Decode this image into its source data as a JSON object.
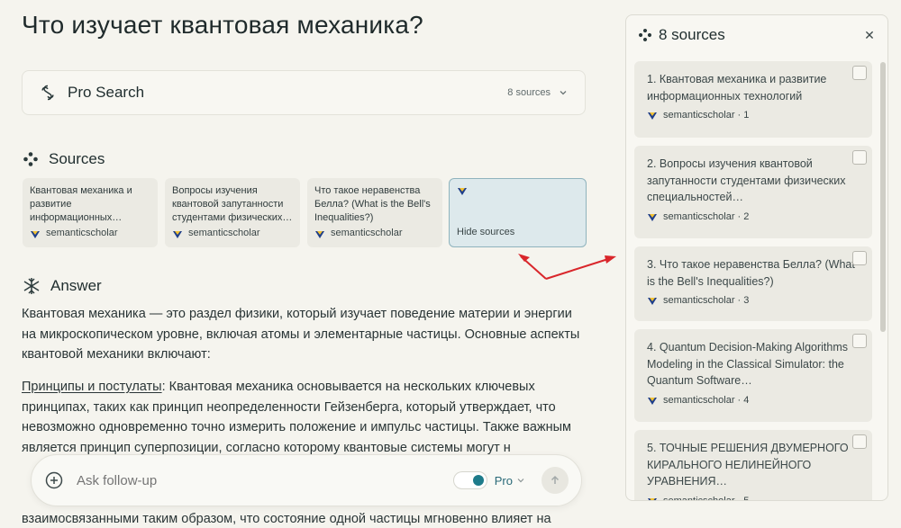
{
  "page_title": "Что изучает квантовая механика?",
  "pro_search": {
    "label": "Pro Search",
    "count": "8 sources"
  },
  "sources_section": {
    "heading": "Sources",
    "cards": [
      {
        "text": "Квантовая механика и развитие информационных…",
        "source": "semanticscholar"
      },
      {
        "text": "Вопросы изучения квантовой запутанности студентами физических…",
        "source": "semanticscholar"
      },
      {
        "text": "Что такое неравенства Белла? (What is the Bell's Inequalities?)",
        "source": "semanticscholar"
      },
      {
        "text": "Hide sources",
        "source": ""
      }
    ]
  },
  "answer": {
    "heading": "Answer",
    "para1": "Квантовая механика — это раздел физики, который изучает поведение материи и энергии на микроскопическом уровне, включая атомы и элементарные частицы. Основные аспекты квантовой механики включают:",
    "para2_term": "Принципы и постулаты",
    "para2_text": ": Квантовая механика основывается на нескольких ключевых принципах, таких как принцип неопределенности Гейзенберга, который утверждает, что невозможно одновременно точно измерить положение и импульс частицы. Также важным является принцип суперпозиции, согласно которому квантовые системы могут н",
    "para3_tail": "взаимосвязанными таким образом, что состояние одной частицы мгновенно влияет на"
  },
  "followup": {
    "placeholder": "Ask follow-up",
    "mode": "Pro"
  },
  "panel": {
    "title": "8 sources",
    "items": [
      {
        "title": "1. Квантовая механика и развитие информационных технологий",
        "meta": "semanticscholar · 1"
      },
      {
        "title": "2. Вопросы изучения квантовой запутанности студентами физических специальностей…",
        "meta": "semanticscholar · 2"
      },
      {
        "title": "3. Что такое неравенства Белла? (What is the Bell's Inequalities?)",
        "meta": "semanticscholar · 3"
      },
      {
        "title": "4. Quantum Decision-Making Algorithms Modeling in the Classical Simulator: the Quantum Software…",
        "meta": "semanticscholar · 4"
      },
      {
        "title": "5. ТОЧНЫЕ РЕШЕНИЯ ДВУМЕРНОГО КИРАЛЬНОГО НЕЛИНЕЙНОГО УРАВНЕНИЯ…",
        "meta": "semanticscholar · 5"
      }
    ]
  },
  "colors": {
    "accent": "#1e7b8a",
    "arrow": "#d9262b",
    "background": "#f5f4ee"
  }
}
